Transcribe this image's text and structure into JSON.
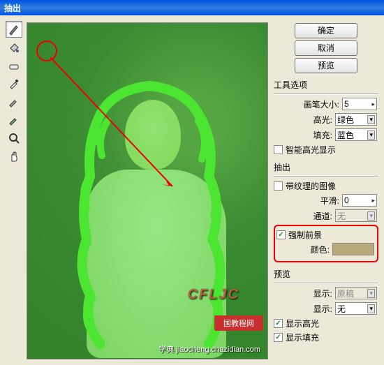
{
  "window": {
    "title": "抽出"
  },
  "buttons": {
    "ok": "确定",
    "cancel": "取消",
    "preview": "预览"
  },
  "tool_options": {
    "title": "工具选项",
    "brush_size_label": "画笔大小:",
    "brush_size_value": "5",
    "highlight_label": "高光:",
    "highlight_value": "绿色",
    "fill_label": "填充:",
    "fill_value": "蓝色",
    "smart_hl_label": "智能高光显示"
  },
  "extract": {
    "title": "抽出",
    "textured_label": "带纹理的图像",
    "smooth_label": "平滑:",
    "smooth_value": "0",
    "channel_label": "通道:",
    "channel_value": "无",
    "force_fg_label": "强制前景",
    "color_label": "颜色:",
    "color_value": "#b8aa78"
  },
  "preview": {
    "title": "预览",
    "view_label": "显示:",
    "view_value": "原稿",
    "display_label": "显示:",
    "display_value": "无",
    "show_hl_label": "显示高光",
    "show_fill_label": "显示填充"
  },
  "watermark": {
    "logo": "CFLJC",
    "badge": "国教程网",
    "url": "学典 jiaocheng.chazidian.com"
  }
}
